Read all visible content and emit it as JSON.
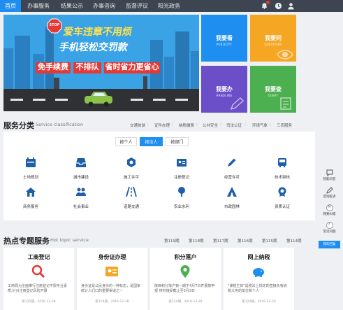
{
  "nav": {
    "items": [
      "首页",
      "办事服务",
      "结果公示",
      "办事咨询",
      "监督评议",
      "阳光政务"
    ],
    "active_index": 0
  },
  "banner": {
    "stop_sign": "STOP",
    "headline1": "爱车违章不用烦",
    "headline2": "手机轻松交罚款",
    "tile1": "免手续费",
    "tile2": "不排队",
    "tile3": "省时省力更省心",
    "slide_count": 3,
    "active_slide": 1
  },
  "quick_links": [
    {
      "title": "我要看",
      "sub": "PUBLICITY",
      "color": "#1e8ff0"
    },
    {
      "title": "我要问",
      "sub": "QUESTIONS",
      "color": "#f5a623"
    },
    {
      "title": "我要办",
      "sub": "HANDLING",
      "color": "#6a4fc8"
    },
    {
      "title": "我要查",
      "sub": "QUERY",
      "color": "#4caf50"
    }
  ],
  "services": {
    "title": "服务分类",
    "subtitle": "Service classification",
    "topic_links": [
      "交通旅游",
      "证件办理",
      "纳税缴费",
      "公共安全",
      "司法公证",
      "环境气象",
      "三农服务"
    ],
    "tabs": [
      "按个人",
      "按法人",
      "按部门"
    ],
    "active_tab": 1,
    "items": [
      {
        "label": "土地规划",
        "icon": "calendar-icon"
      },
      {
        "label": "城市建设",
        "icon": "inbox-icon"
      },
      {
        "label": "施工许可",
        "icon": "gear-icon"
      },
      {
        "label": "注册登记",
        "icon": "id-card-icon"
      },
      {
        "label": "经营许可",
        "icon": "pen-icon"
      },
      {
        "label": "技术审核",
        "icon": "bus-icon"
      },
      {
        "label": "商务服务",
        "icon": "house-icon"
      },
      {
        "label": "社会事业",
        "icon": "people-icon"
      },
      {
        "label": "道路交通",
        "icon": "road-icon"
      },
      {
        "label": "农业水利",
        "icon": "tree-icon"
      },
      {
        "label": "市政园林",
        "icon": "tent-icon"
      },
      {
        "label": "资质认证",
        "icon": "medal-icon"
      }
    ]
  },
  "side": {
    "items": [
      "智能问答",
      "咨询投诉",
      "我要纠错",
      "常见问题"
    ],
    "button": "我的回复"
  },
  "hot": {
    "title": "热点专题服务",
    "subtitle": "Hot topic service",
    "periods": [
      "第119期",
      "第118期",
      "第117期",
      "第116期",
      "第115期",
      "第114期"
    ],
    "cards": [
      {
        "title": "工商登记",
        "icon": "magnifier-icon",
        "color": "#e53935",
        "desc": "工商局为全面推行注册登记不限专业素质,针对注册登记风险开展",
        "meta": "第125期，2016-12-28"
      },
      {
        "title": "身份证办理",
        "icon": "id-card-icon",
        "color": "#f5a623",
        "desc": "身份证是公民身份的一种标志，是国家统计人们口的重要渠道之一",
        "meta": "第124期，2016-12-28"
      },
      {
        "title": "积分落户",
        "icon": "pin-icon",
        "color": "#4caf50",
        "desc": "陕西积分落户第一期于4月7日开展按申报 材料接受截止至5月3日",
        "meta": "第124期，2016-12-28"
      },
      {
        "title": "网上纳税",
        "icon": "piggy-bank-icon",
        "color": "#1e8ff0",
        "desc": "\"课税主体\"是税法上规定的直接负有纳税义务的单位和个人",
        "meta": "第124期，2016-12-28"
      }
    ]
  }
}
